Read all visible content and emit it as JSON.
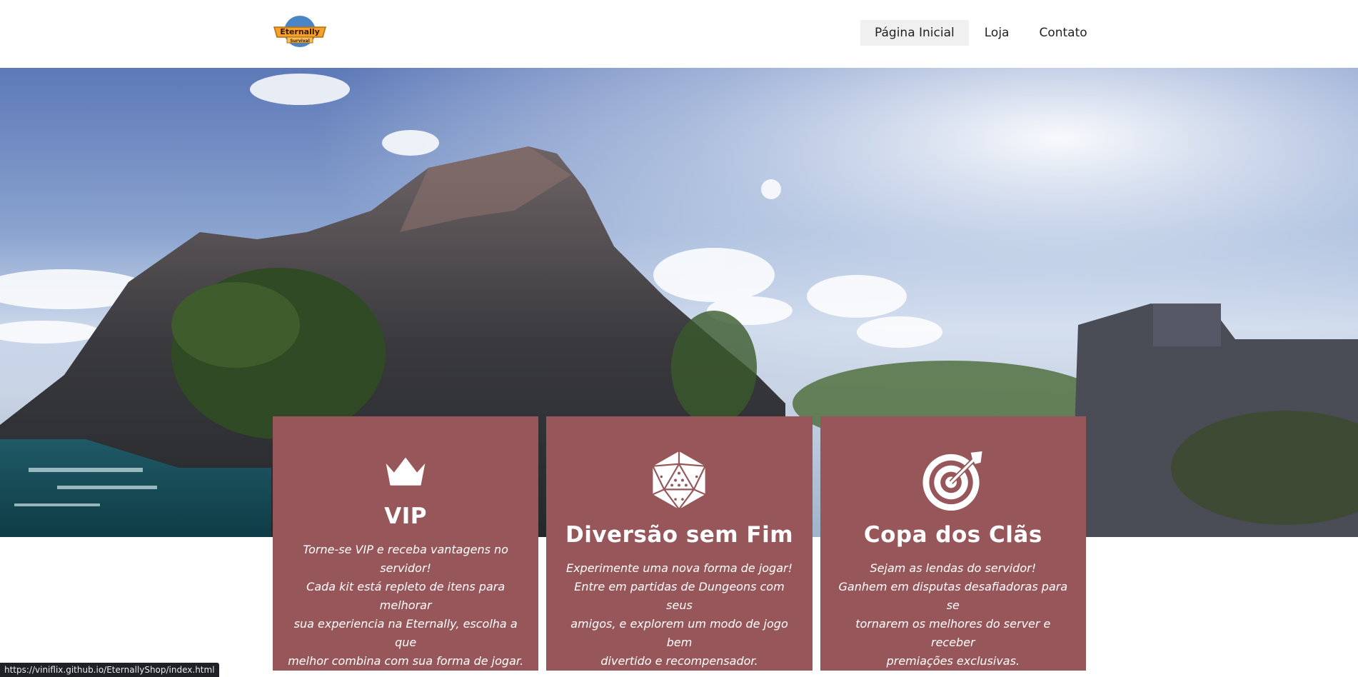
{
  "header": {
    "logo_alt": "Eternally Survival",
    "nav": [
      {
        "label": "Página Inicial",
        "active": true
      },
      {
        "label": "Loja",
        "active": false
      },
      {
        "label": "Contato",
        "active": false
      }
    ]
  },
  "logo": {
    "word1": "Eternally",
    "word2": "Survival"
  },
  "cards": [
    {
      "icon": "crown-icon",
      "title": "VIP",
      "lines": [
        "Torne-se VIP e receba vantagens no servidor!",
        "Cada kit está repleto de itens para melhorar",
        "sua experiencia na Eternally, escolha a que",
        "melhor combina com sua forma de jogar."
      ]
    },
    {
      "icon": "d20-dice-icon",
      "title": "Diversão sem Fim",
      "lines": [
        "Experimente uma nova forma de jogar!",
        "Entre em partidas de Dungeons com seus",
        "amigos, e explorem um modo de jogo bem",
        "divertido e recompensador."
      ]
    },
    {
      "icon": "target-arrow-icon",
      "title": "Copa dos Clãs",
      "lines": [
        "Sejam as lendas do servidor!",
        "Ganhem em disputas desafiadoras para se",
        "tornarem os melhores do server e receber",
        "premiações exclusivas."
      ]
    }
  ],
  "status_url": "https://viniflix.github.io/EternallyShop/index.html",
  "colors": {
    "card_bg": "#97575a",
    "nav_active_bg": "#f0f0f0"
  }
}
